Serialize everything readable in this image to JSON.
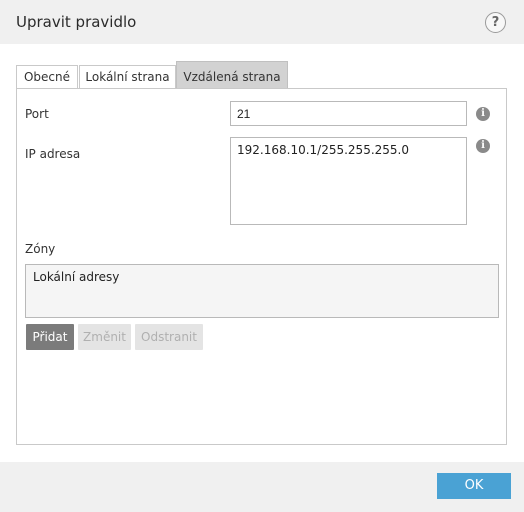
{
  "dialog": {
    "title": "Upravit pravidlo",
    "help_glyph": "?"
  },
  "tabs": [
    {
      "label": "Obecné",
      "active": false
    },
    {
      "label": "Lokální strana",
      "active": false
    },
    {
      "label": "Vzdálená strana",
      "active": true
    }
  ],
  "form": {
    "port_label": "Port",
    "port_value": "21",
    "ip_label": "IP adresa",
    "ip_value": "192.168.10.1/255.255.255.0",
    "zones_label": "Zóny",
    "zones_items": [
      "Lokální adresy"
    ]
  },
  "buttons": {
    "add": "Přidat",
    "edit": "Změnit",
    "remove": "Odstranit"
  },
  "footer": {
    "ok": "OK"
  },
  "colors": {
    "accent": "#4aa2d4",
    "primary_button": "#7b7b7b",
    "active_tab": "#d2d2d2"
  },
  "icons": {
    "help": "question-circle-icon",
    "info": "info-circle-icon"
  }
}
